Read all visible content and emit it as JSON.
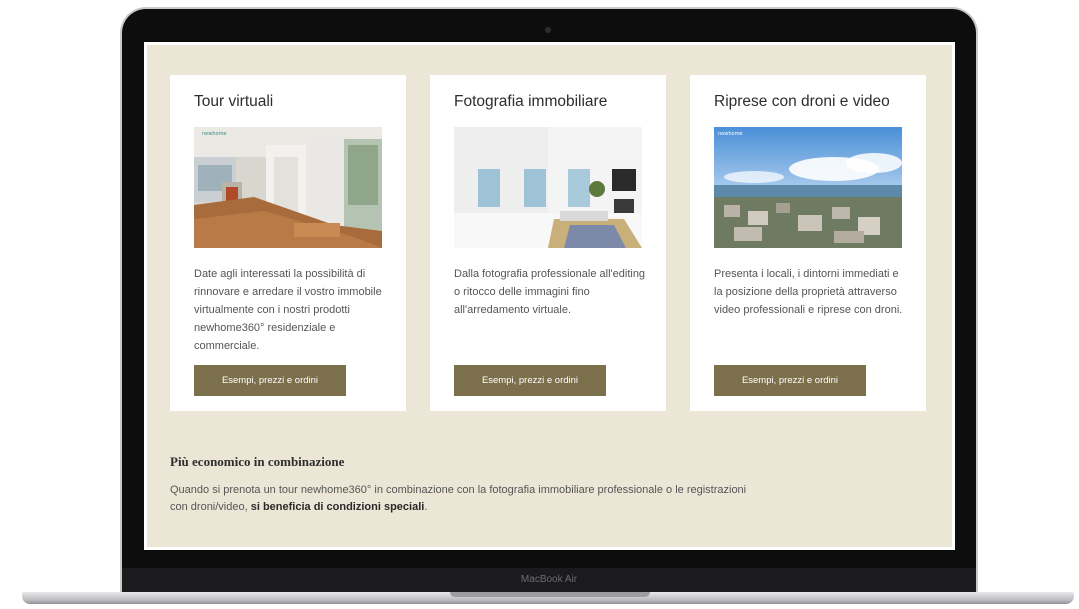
{
  "device": {
    "label": "MacBook Air"
  },
  "cards": [
    {
      "title": "Tour virtuali",
      "text": "Date agli interessati la possibilità di rinnovare e arredare il vostro immobile virtualmente con i nostri prodotti newhome360° residenziale e commerciale.",
      "button": "Esempi, prezzi e ordini"
    },
    {
      "title": "Fotografia immobiliare",
      "text": "Dalla fotografia professionale all'editing o ritocco delle immagini fino all'arredamento virtuale.",
      "button": "Esempi, prezzi e ordini"
    },
    {
      "title": "Riprese con droni e video",
      "text": "Presenta i locali, i dintorni immediati e la posizione della proprietà attraverso video professionali e riprese con droni.",
      "button": "Esempi, prezzi e ordini"
    }
  ],
  "combo": {
    "title": "Più economico in combinazione",
    "text_before": "Quando si prenota un tour newhome360° in combinazione con la fotografia immobiliare professionale o le registrazioni con droni/video, ",
    "text_bold": "si beneficia di condizioni speciali",
    "text_after": "."
  },
  "colors": {
    "page_background": "#ece6d6",
    "button": "#7c6f4b",
    "card": "#ffffff"
  }
}
